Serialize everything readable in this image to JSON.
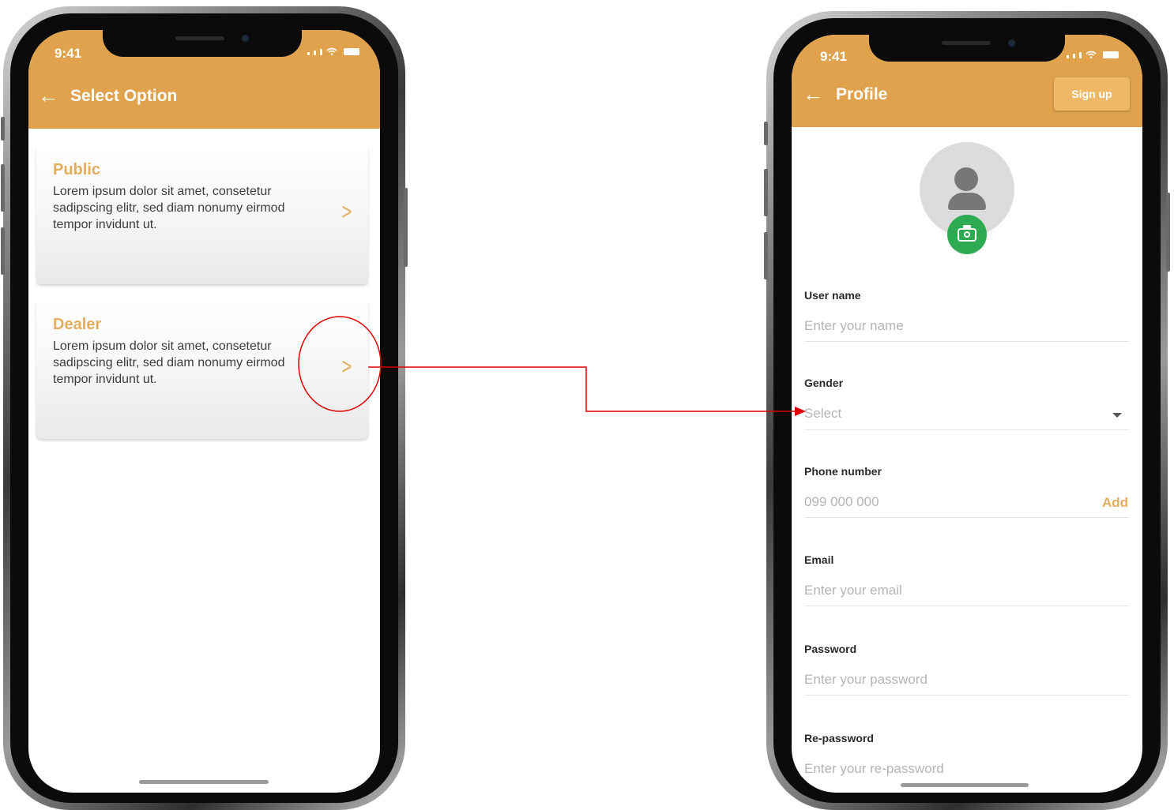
{
  "left_phone": {
    "status": {
      "time": "9:41"
    },
    "appbar": {
      "title": "Select Option",
      "back_icon": "arrow-left-icon"
    },
    "cards": [
      {
        "title": "Public",
        "description": "Lorem ipsum dolor sit amet, consetetur sadipscing elitr, sed diam nonumy eirmod tempor invidunt ut.",
        "icon": "chevron-right-icon"
      },
      {
        "title": "Dealer",
        "description": "Lorem ipsum dolor sit amet, consetetur sadipscing elitr, sed diam nonumy eirmod tempor invidunt ut.",
        "icon": "chevron-right-icon"
      }
    ]
  },
  "right_phone": {
    "status": {
      "time": "9:41"
    },
    "appbar": {
      "title": "Profile",
      "back_icon": "arrow-left-icon",
      "signup_label": "Sign up"
    },
    "avatar": {
      "icon": "user-icon",
      "badge_icon": "camera-icon"
    },
    "form": {
      "username": {
        "label": "User name",
        "placeholder": "Enter your name"
      },
      "gender": {
        "label": "Gender",
        "value": "Select"
      },
      "phone": {
        "label": "Phone number",
        "placeholder": "099 000 000",
        "action": "Add"
      },
      "email": {
        "label": "Email",
        "placeholder": "Enter your email"
      },
      "password": {
        "label": "Password",
        "placeholder": "Enter your password"
      },
      "repassword": {
        "label": "Re-password",
        "placeholder": "Enter your re-password"
      }
    }
  },
  "colors": {
    "appbar": "#e0a24d",
    "accent": "#e3ae5c",
    "camera_badge": "#2eaa53",
    "annotation": "#e00000"
  }
}
